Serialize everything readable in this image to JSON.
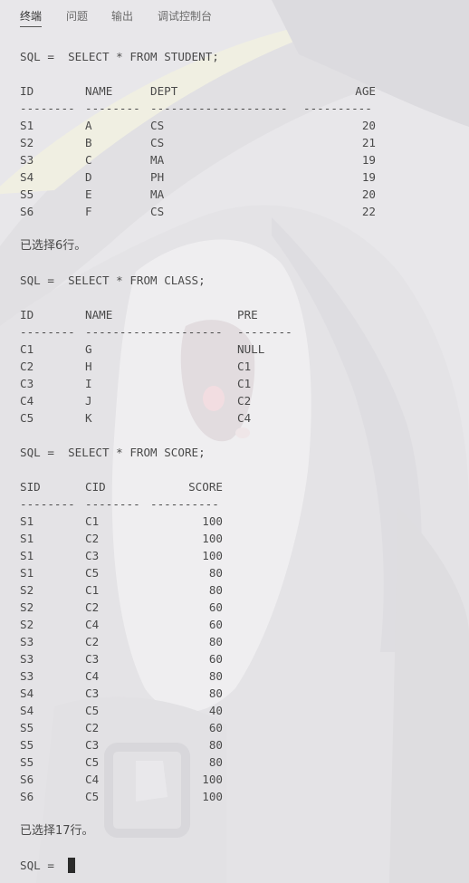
{
  "tabs": [
    {
      "label": "终端",
      "active": true
    },
    {
      "label": "问题",
      "active": false
    },
    {
      "label": "输出",
      "active": false
    },
    {
      "label": "调试控制台",
      "active": false
    }
  ],
  "prompt": "SQL = ",
  "queries": [
    {
      "command": "SQL =  SELECT * FROM STUDENT;",
      "columns": [
        "ID",
        "NAME",
        "DEPT",
        "AGE"
      ],
      "separators": [
        "--------",
        "--------",
        "--------------------",
        "----------"
      ],
      "rows": [
        [
          "S1",
          "A",
          "CS",
          "20"
        ],
        [
          "S2",
          "B",
          "CS",
          "21"
        ],
        [
          "S3",
          "C",
          "MA",
          "19"
        ],
        [
          "S4",
          "D",
          "PH",
          "19"
        ],
        [
          "S5",
          "E",
          "MA",
          "20"
        ],
        [
          "S6",
          "F",
          "CS",
          "22"
        ]
      ],
      "result": "已选择6行。"
    },
    {
      "command": "SQL =  SELECT * FROM CLASS;",
      "columns": [
        "ID",
        "NAME",
        "PRE"
      ],
      "separators": [
        "--------",
        "--------------------",
        "--------"
      ],
      "rows": [
        [
          "C1",
          "G",
          "NULL"
        ],
        [
          "C2",
          "H",
          "C1"
        ],
        [
          "C3",
          "I",
          "C1"
        ],
        [
          "C4",
          "J",
          "C2"
        ],
        [
          "C5",
          "K",
          "C4"
        ]
      ],
      "result": ""
    },
    {
      "command": "SQL =  SELECT * FROM SCORE;",
      "columns": [
        "SID",
        "CID",
        "SCORE"
      ],
      "separators": [
        "--------",
        "--------",
        "----------"
      ],
      "rows": [
        [
          "S1",
          "C1",
          "100"
        ],
        [
          "S1",
          "C2",
          "100"
        ],
        [
          "S1",
          "C3",
          "100"
        ],
        [
          "S1",
          "C5",
          "80"
        ],
        [
          "S2",
          "C1",
          "80"
        ],
        [
          "S2",
          "C2",
          "60"
        ],
        [
          "S2",
          "C4",
          "60"
        ],
        [
          "S3",
          "C2",
          "80"
        ],
        [
          "S3",
          "C3",
          "60"
        ],
        [
          "S3",
          "C4",
          "80"
        ],
        [
          "S4",
          "C3",
          "80"
        ],
        [
          "S4",
          "C5",
          "40"
        ],
        [
          "S5",
          "C2",
          "60"
        ],
        [
          "S5",
          "C3",
          "80"
        ],
        [
          "S5",
          "C5",
          "80"
        ],
        [
          "S6",
          "C4",
          "100"
        ],
        [
          "S6",
          "C5",
          "100"
        ]
      ],
      "result": "已选择17行。"
    }
  ]
}
